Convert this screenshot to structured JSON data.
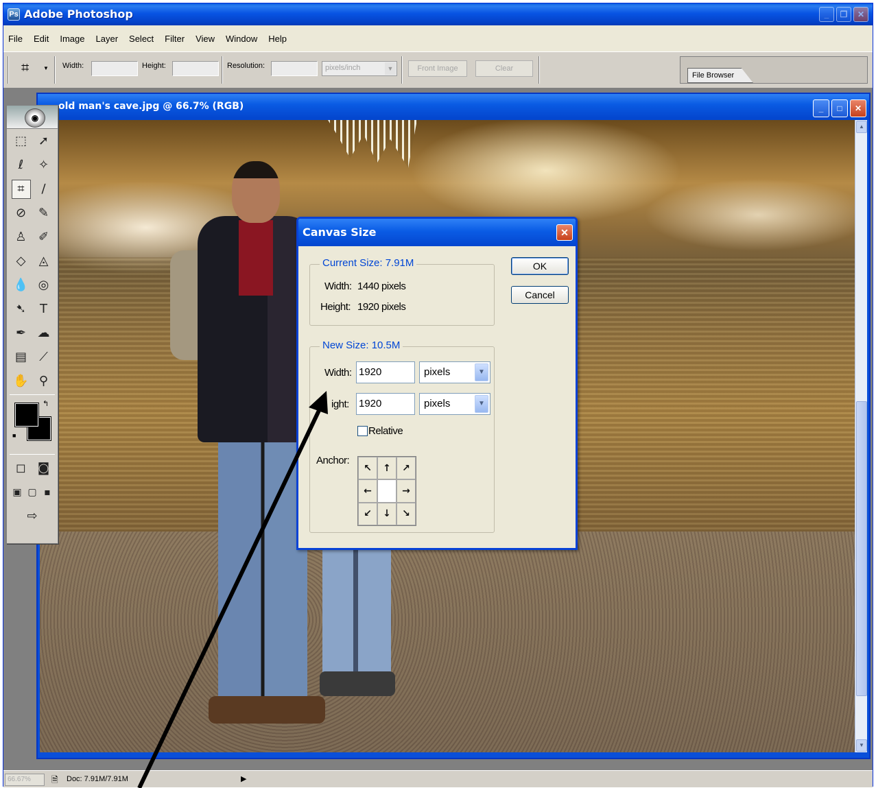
{
  "app": {
    "title": "Adobe Photoshop",
    "icon": "photoshop-app-icon",
    "window_buttons": [
      "minimize",
      "restore",
      "close"
    ]
  },
  "menubar": {
    "items": [
      "File",
      "Edit",
      "Image",
      "Layer",
      "Select",
      "Filter",
      "View",
      "Window",
      "Help"
    ]
  },
  "options_bar": {
    "tool_icon": "crop-tool-icon",
    "width_label": "Width:",
    "width_value": "",
    "height_label": "Height:",
    "height_value": "",
    "resolution_label": "Resolution:",
    "resolution_value": "",
    "resolution_unit": "pixels/inch",
    "front_image_label": "Front Image",
    "clear_label": "Clear",
    "file_browser_tab": "File Browser"
  },
  "document": {
    "title": "old man's cave.jpg @ 66.7% (RGB)"
  },
  "toolbox": {
    "logo": "photoshop-eye-logo",
    "tools": [
      [
        "marquee-tool-icon",
        "move-tool-icon"
      ],
      [
        "lasso-tool-icon",
        "magic-wand-tool-icon"
      ],
      [
        "crop-tool-icon",
        "slice-tool-icon"
      ],
      [
        "healing-brush-tool-icon",
        "brush-tool-icon"
      ],
      [
        "clone-stamp-tool-icon",
        "history-brush-tool-icon"
      ],
      [
        "eraser-tool-icon",
        "paint-bucket-tool-icon"
      ],
      [
        "blur-tool-icon",
        "dodge-tool-icon"
      ],
      [
        "path-selection-tool-icon",
        "type-tool-icon"
      ],
      [
        "pen-tool-icon",
        "custom-shape-tool-icon"
      ],
      [
        "notes-tool-icon",
        "eyedropper-tool-icon"
      ],
      [
        "hand-tool-icon",
        "zoom-tool-icon"
      ]
    ],
    "type_tool_glyph": "T",
    "foreground_color": "#000000",
    "background_color": "#000000"
  },
  "dialog": {
    "title": "Canvas Size",
    "current_size_legend": "Current Size: 7.91M",
    "current_width_label": "Width:",
    "current_width_value": "1440 pixels",
    "current_height_label": "Height:",
    "current_height_value": "1920 pixels",
    "new_size_legend": "New Size: 10.5M",
    "new_width_label": "Width:",
    "new_width_value": "1920",
    "new_width_unit": "pixels",
    "new_height_label": "ight:",
    "new_height_value": "1920",
    "new_height_unit": "pixels",
    "relative_label": "Relative",
    "relative_checked": false,
    "anchor_label": "Anchor:",
    "ok_label": "OK",
    "cancel_label": "Cancel"
  },
  "statusbar": {
    "zoom": "66.67%",
    "doc_info": "Doc: 7.91M/7.91M"
  },
  "colors": {
    "title_blue": "#0a5be3",
    "dialog_face": "#ece9d8",
    "legend_blue": "#0046d5",
    "close_red": "#c7401b"
  }
}
